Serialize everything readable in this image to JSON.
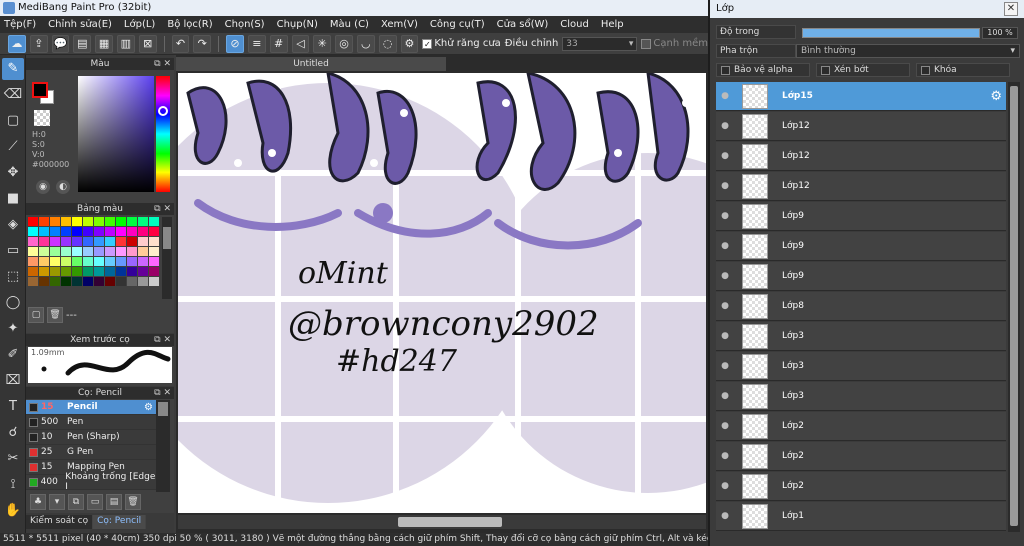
{
  "window": {
    "title": "MediBang Paint Pro (32bit)"
  },
  "menu": [
    "Tệp(F)",
    "Chỉnh sửa(E)",
    "Lớp(L)",
    "Bộ lọc(R)",
    "Chọn(S)",
    "Chụp(N)",
    "Màu (C)",
    "Xem(V)",
    "Công cụ(T)",
    "Cửa sổ(W)",
    "Cloud",
    "Help"
  ],
  "toolbar": {
    "antialias_label": "Khử răng cưa",
    "adjust_label": "Điều chỉnh",
    "adjust_value": "33",
    "smooth_edges_label": "Cạnh mềm"
  },
  "color_panel": {
    "title": "Màu",
    "h_label": "H:0",
    "s_label": "S:0",
    "v_label": "V:0",
    "hex": "#000000",
    "fg_color": "#000000",
    "bg_color": "#ffffff"
  },
  "palette_panel": {
    "title": "Bảng màu",
    "page_label": "---",
    "colors": [
      "#ff0000",
      "#ff4000",
      "#ff8000",
      "#ffbf00",
      "#ffff00",
      "#bfff00",
      "#80ff00",
      "#40ff00",
      "#00ff00",
      "#00ff40",
      "#00ff80",
      "#00ffbf",
      "#00ffff",
      "#00bfff",
      "#0080ff",
      "#0040ff",
      "#0000ff",
      "#4000ff",
      "#8000ff",
      "#bf00ff",
      "#ff00ff",
      "#ff00bf",
      "#ff0080",
      "#ff0040",
      "#ff66cc",
      "#ff3399",
      "#cc33ff",
      "#9933ff",
      "#6633ff",
      "#3366ff",
      "#3399ff",
      "#33ccff",
      "#ff3333",
      "#cc0000",
      "#ffcccc",
      "#ffe0cc",
      "#ffff99",
      "#ccff99",
      "#99ff99",
      "#99ffcc",
      "#99ffff",
      "#99ccff",
      "#9999ff",
      "#cc99ff",
      "#ff99ff",
      "#ff99cc",
      "#ffcc99",
      "#ffeecc",
      "#ff9966",
      "#ffcc66",
      "#ffff66",
      "#ccff66",
      "#66ff66",
      "#66ffcc",
      "#66ffff",
      "#66ccff",
      "#6699ff",
      "#9966ff",
      "#cc66ff",
      "#ff66ff",
      "#cc6600",
      "#cc9900",
      "#999900",
      "#669900",
      "#339900",
      "#009966",
      "#009999",
      "#006699",
      "#003399",
      "#330099",
      "#660099",
      "#990066",
      "#996633",
      "#663300",
      "#336600",
      "#003300",
      "#003333",
      "#000066",
      "#330033",
      "#660000",
      "#333333",
      "#666666",
      "#999999",
      "#cccccc"
    ]
  },
  "preview_panel": {
    "title": "Xem trước cọ",
    "size": "1.09mm"
  },
  "brush_panel": {
    "title": "Cọ: Pencil",
    "items": [
      {
        "size": "15",
        "name": "Pencil",
        "color": "#222222",
        "active": true
      },
      {
        "size": "500",
        "name": "Pen",
        "color": "#222222",
        "active": false
      },
      {
        "size": "10",
        "name": "Pen (Sharp)",
        "color": "#222222",
        "active": false
      },
      {
        "size": "25",
        "name": "G Pen",
        "color": "#e03030",
        "active": false
      },
      {
        "size": "15",
        "name": "Mapping Pen",
        "color": "#e03030",
        "active": false
      },
      {
        "size": "400",
        "name": "Khoảng trống [Edge I",
        "color": "#22aa22",
        "active": false
      }
    ]
  },
  "panel_tabs": [
    "Kiểm soát cọ",
    "Cọ: Pencil"
  ],
  "document": {
    "tab": "Untitled"
  },
  "canvas_text": {
    "line1": "oMint",
    "line2": "@browncony2902",
    "line3": "#hd247"
  },
  "statusbar": {
    "dimensions": "5511 * 5511 pixel",
    "physical": "(40 * 40cm)",
    "dpi": "350 dpi",
    "zoom": "50 %",
    "coords": "( 3011, 3180 )",
    "hint": "Vẽ một đường thẳng bằng cách giữ phím Shift, Thay đổi cỡ cọ bằng cách giữ phím Ctrl, Alt và kéo"
  },
  "layer_window": {
    "title": "Lớp",
    "opacity_label": "Độ trong",
    "opacity_value": "100 %",
    "opacity": 1.0,
    "blend_label": "Pha trộn",
    "blend_value": "Bình thường",
    "protect_alpha": "Bảo vệ alpha",
    "clipping": "Xén bớt",
    "lock": "Khóa",
    "layers": [
      {
        "name": "Lớp15",
        "active": true
      },
      {
        "name": "Lớp12",
        "active": false
      },
      {
        "name": "Lớp12",
        "active": false
      },
      {
        "name": "Lớp12",
        "active": false
      },
      {
        "name": "Lớp9",
        "active": false
      },
      {
        "name": "Lớp9",
        "active": false
      },
      {
        "name": "Lớp9",
        "active": false
      },
      {
        "name": "Lớp8",
        "active": false
      },
      {
        "name": "Lớp3",
        "active": false
      },
      {
        "name": "Lớp3",
        "active": false
      },
      {
        "name": "Lớp3",
        "active": false
      },
      {
        "name": "Lớp2",
        "active": false
      },
      {
        "name": "Lớp2",
        "active": false
      },
      {
        "name": "Lớp2",
        "active": false
      },
      {
        "name": "Lớp1",
        "active": false
      }
    ]
  }
}
